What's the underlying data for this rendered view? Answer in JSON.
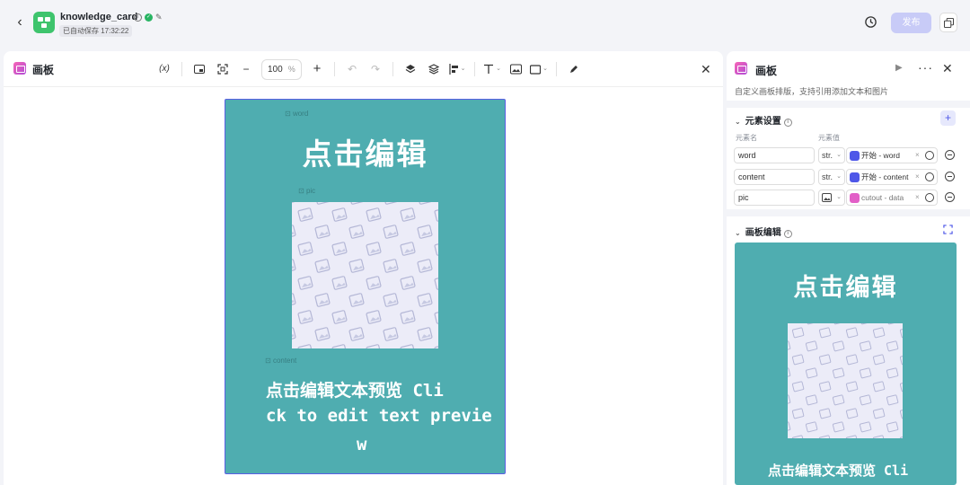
{
  "app": {
    "name": "knowledge_card",
    "save_status": "已自动保存 17:32:22",
    "publish_label": "发布"
  },
  "editor": {
    "title": "画板",
    "variable_button": "(x)",
    "zoom_value": "100",
    "zoom_unit": "%"
  },
  "canvas": {
    "background": "#4fadb0",
    "word_tag": "word",
    "pic_tag": "pic",
    "content_tag": "content",
    "headline": "点击编辑",
    "content_line1": "点击编辑文本预览 Cli",
    "content_line2": "ck to edit text previe",
    "content_line3": "w"
  },
  "panel": {
    "title": "画板",
    "description": "自定义画板排版，支持引用添加文本和图片",
    "elements_section": "元素设置",
    "col_name": "元素名",
    "col_value": "元素值",
    "elements": [
      {
        "name": "word",
        "type": "str.",
        "ref": "开始 - word",
        "icon": "start-node-icon"
      },
      {
        "name": "content",
        "type": "str.",
        "ref": "开始 - content",
        "icon": "start-node-icon"
      },
      {
        "name": "pic",
        "type": "image",
        "ref": "cutout - data",
        "icon": "cutout-node-icon"
      }
    ],
    "canvas_section": "画板编辑",
    "preview_headline": "点击编辑",
    "preview_content": "点击编辑文本预览 Cli"
  },
  "colors": {
    "accent": "#4e57e8",
    "canvas_teal": "#4fadb0",
    "selection_border": "#5b60e4",
    "publish_disabled": "#c8cbf7"
  }
}
